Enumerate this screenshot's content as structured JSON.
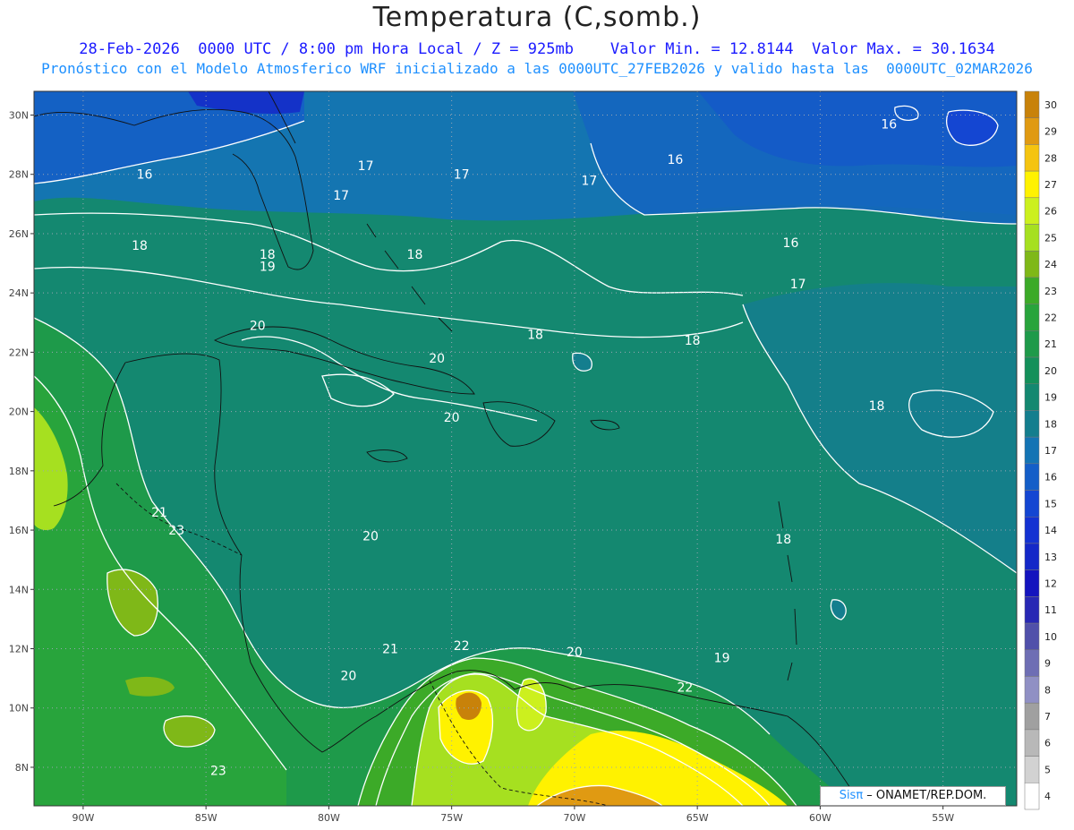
{
  "title": "Temperatura (C,somb.)",
  "subtitle_line1": "28-Feb-2026  0000 UTC / 8:00 pm Hora Local / Z = 925mb    Valor Min. = 12.8144  Valor Max. = 30.1634",
  "subtitle_line2": "Pronóstico con el Modelo Atmosferico WRF inicializado a las 0000UTC_27FEB2026 y valido hasta las  0000UTC_02MAR2026",
  "credit": {
    "logo": "Sisπ",
    "text": " – ONAMET/REP.DOM."
  },
  "lat_ticks": [
    "30N",
    "28N",
    "26N",
    "24N",
    "22N",
    "20N",
    "18N",
    "16N",
    "14N",
    "12N",
    "10N",
    "8N"
  ],
  "lon_ticks": [
    "90W",
    "85W",
    "80W",
    "75W",
    "70W",
    "65W",
    "60W",
    "55W"
  ],
  "colorbar": {
    "levels": [
      "30",
      "29",
      "28",
      "27",
      "26",
      "25",
      "24",
      "23",
      "22",
      "21",
      "20",
      "19",
      "18",
      "17",
      "16",
      "15",
      "14",
      "13",
      "12",
      "11",
      "10",
      "9",
      "8",
      "7",
      "6",
      "5",
      "4"
    ],
    "colors": [
      "#c8820a",
      "#e09a12",
      "#f5c410",
      "#fff200",
      "#ccf01e",
      "#a6e020",
      "#7fb818",
      "#3caa28",
      "#28a43c",
      "#1e9a4a",
      "#14905a",
      "#148870",
      "#147e8e",
      "#1474b4",
      "#145ec8",
      "#1446d2",
      "#1432d2",
      "#1428c8",
      "#1414be",
      "#2828b4",
      "#5050aa",
      "#6e6eb4",
      "#9090c4",
      "#a0a0a0",
      "#b8b8b8",
      "#d2d2d2",
      "#ffffff"
    ]
  },
  "contour_labels": [
    {
      "text": "16",
      "lat": 29.7,
      "lon": -57.2
    },
    {
      "text": "16",
      "lat": 28.5,
      "lon": -65.9
    },
    {
      "text": "16",
      "lat": 28.0,
      "lon": -87.5
    },
    {
      "text": "17",
      "lat": 27.3,
      "lon": -79.5
    },
    {
      "text": "17",
      "lat": 28.3,
      "lon": -78.5
    },
    {
      "text": "17",
      "lat": 28.0,
      "lon": -74.6
    },
    {
      "text": "17",
      "lat": 27.8,
      "lon": -69.4
    },
    {
      "text": "16",
      "lat": 25.7,
      "lon": -61.2
    },
    {
      "text": "17",
      "lat": 24.3,
      "lon": -60.9
    },
    {
      "text": "18",
      "lat": 25.6,
      "lon": -87.7
    },
    {
      "text": "18",
      "lat": 25.3,
      "lon": -82.5
    },
    {
      "text": "19",
      "lat": 24.9,
      "lon": -82.5
    },
    {
      "text": "18",
      "lat": 25.3,
      "lon": -76.5
    },
    {
      "text": "20",
      "lat": 22.9,
      "lon": -82.9
    },
    {
      "text": "18",
      "lat": 22.6,
      "lon": -71.6
    },
    {
      "text": "18",
      "lat": 22.4,
      "lon": -65.2
    },
    {
      "text": "20",
      "lat": 21.8,
      "lon": -75.6
    },
    {
      "text": "18",
      "lat": 20.2,
      "lon": -57.7
    },
    {
      "text": "20",
      "lat": 19.8,
      "lon": -75.0
    },
    {
      "text": "21",
      "lat": 16.6,
      "lon": -86.9
    },
    {
      "text": "23",
      "lat": 16.0,
      "lon": -86.2
    },
    {
      "text": "20",
      "lat": 15.8,
      "lon": -78.3
    },
    {
      "text": "18",
      "lat": 15.7,
      "lon": -61.5
    },
    {
      "text": "21",
      "lat": 12.0,
      "lon": -77.5
    },
    {
      "text": "22",
      "lat": 12.1,
      "lon": -74.6
    },
    {
      "text": "20",
      "lat": 11.9,
      "lon": -70.0
    },
    {
      "text": "19",
      "lat": 11.7,
      "lon": -64.0
    },
    {
      "text": "20",
      "lat": 11.1,
      "lon": -79.2
    },
    {
      "text": "22",
      "lat": 10.7,
      "lon": -65.5
    },
    {
      "text": "23",
      "lat": 7.9,
      "lon": -84.5
    }
  ]
}
